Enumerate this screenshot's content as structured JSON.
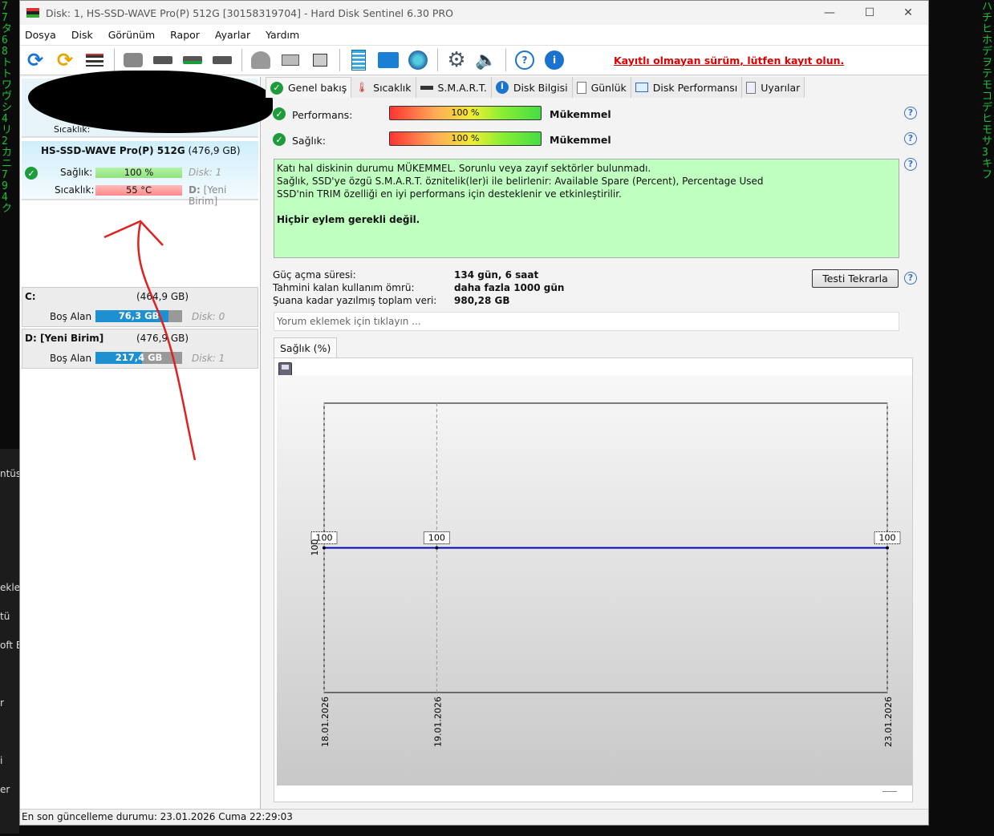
{
  "window": {
    "title": "Disk: 1, HS-SSD-WAVE Pro(P) 512G [30158319704]  -  Hard Disk Sentinel 6.30 PRO"
  },
  "menu": [
    "Dosya",
    "Disk",
    "Görünüm",
    "Rapor",
    "Ayarlar",
    "Yardım"
  ],
  "toolbar": {
    "register_link": "Kayıtlı olmayan sürüm, lütfen kayıt olun.",
    "icons": [
      "refresh-icon",
      "refresh-warning-icon",
      "disk-list-icon",
      "disk-surface-icon",
      "disk-clock-icon",
      "disk-check-icon",
      "disk-search-icon",
      "disk-gray-icon",
      "acoustic-icon",
      "drive-icon",
      "notes-icon",
      "mail-icon",
      "network-icon",
      "settings-icon",
      "speaker-icon",
      "help-icon",
      "info-icon"
    ]
  },
  "disk": {
    "name": "HS-SSD-WAVE Pro(P) 512G",
    "size": "(476,9 GB)",
    "health_label": "Sağlık:",
    "health": "100 %",
    "health_value": 100,
    "temp_label": "Sıcaklık:",
    "temp": "55 °C",
    "disk_num": "Disk: 1",
    "drive": "D:",
    "drive_name": "[Yeni Birim]",
    "hidden_temp_label": "Sıcaklık:"
  },
  "volumes": [
    {
      "letter": "C:",
      "size": "(464,9 GB)",
      "free_label": "Boş Alan",
      "free": "76,3 GB",
      "free_fraction": 0.84,
      "disk": "Disk: 0"
    },
    {
      "letter": "D: [Yeni Birim]",
      "size": "(476,9 GB)",
      "free_label": "Boş Alan",
      "free": "217,4 GB",
      "free_fraction": 0.54,
      "disk": "Disk: 1"
    }
  ],
  "tabs": [
    "Genel bakış",
    "Sıcaklık",
    "S.M.A.R.T.",
    "Disk Bilgisi",
    "Günlük",
    "Disk Performansı",
    "Uyarılar"
  ],
  "overview": {
    "performance_label": "Performans:",
    "performance": "100 %",
    "performance_value": 100,
    "performance_rating": "Mükemmel",
    "health_label": "Sağlık:",
    "health": "100 %",
    "health_value": 100,
    "health_rating": "Mükemmel",
    "info_lines": [
      "Katı hal diskinin durumu MÜKEMMEL. Sorunlu veya zayıf sektörler bulunmadı.",
      "Sağlık, SSD'ye özgü S.M.A.R.T. öznitelik(ler)i ile belirlenir:  Available Spare (Percent), Percentage Used",
      "SSD'nin TRIM özelliği en iyi performans için desteklenir ve etkinleştirilir."
    ],
    "info_action": "Hiçbir eylem gerekli değil.",
    "stats": [
      {
        "label": "Güç açma süresi:",
        "value": "134 gün, 6 saat"
      },
      {
        "label": "Tahmini kalan kullanım ömrü:",
        "value": "daha fazla 1000 gün"
      },
      {
        "label": "Şuana kadar yazılmış toplam veri:",
        "value": "980,28 GB"
      }
    ],
    "retest_button": "Testi Tekrarla",
    "comment_placeholder": "Yorum eklemek için tıklayın ...",
    "chart_tab": "Sağlık (%)"
  },
  "chart_data": {
    "type": "line",
    "title": "Sağlık (%)",
    "x": [
      "18.01.2026",
      "19.01.2026",
      "23.01.2026"
    ],
    "x_days": [
      0,
      1,
      5
    ],
    "values": [
      100,
      100,
      100
    ],
    "point_labels": [
      "100",
      "100",
      "100"
    ],
    "ytick": "100",
    "ylim": [
      99.5,
      100.5
    ],
    "line_color": "#0000b0"
  },
  "status": "En son güncelleme durumu: 23.01.2026 Cuma 22:29:03",
  "desktop": [
    "ntüs",
    "ekle",
    "tü",
    "oft E",
    "r",
    "i",
    "er"
  ]
}
